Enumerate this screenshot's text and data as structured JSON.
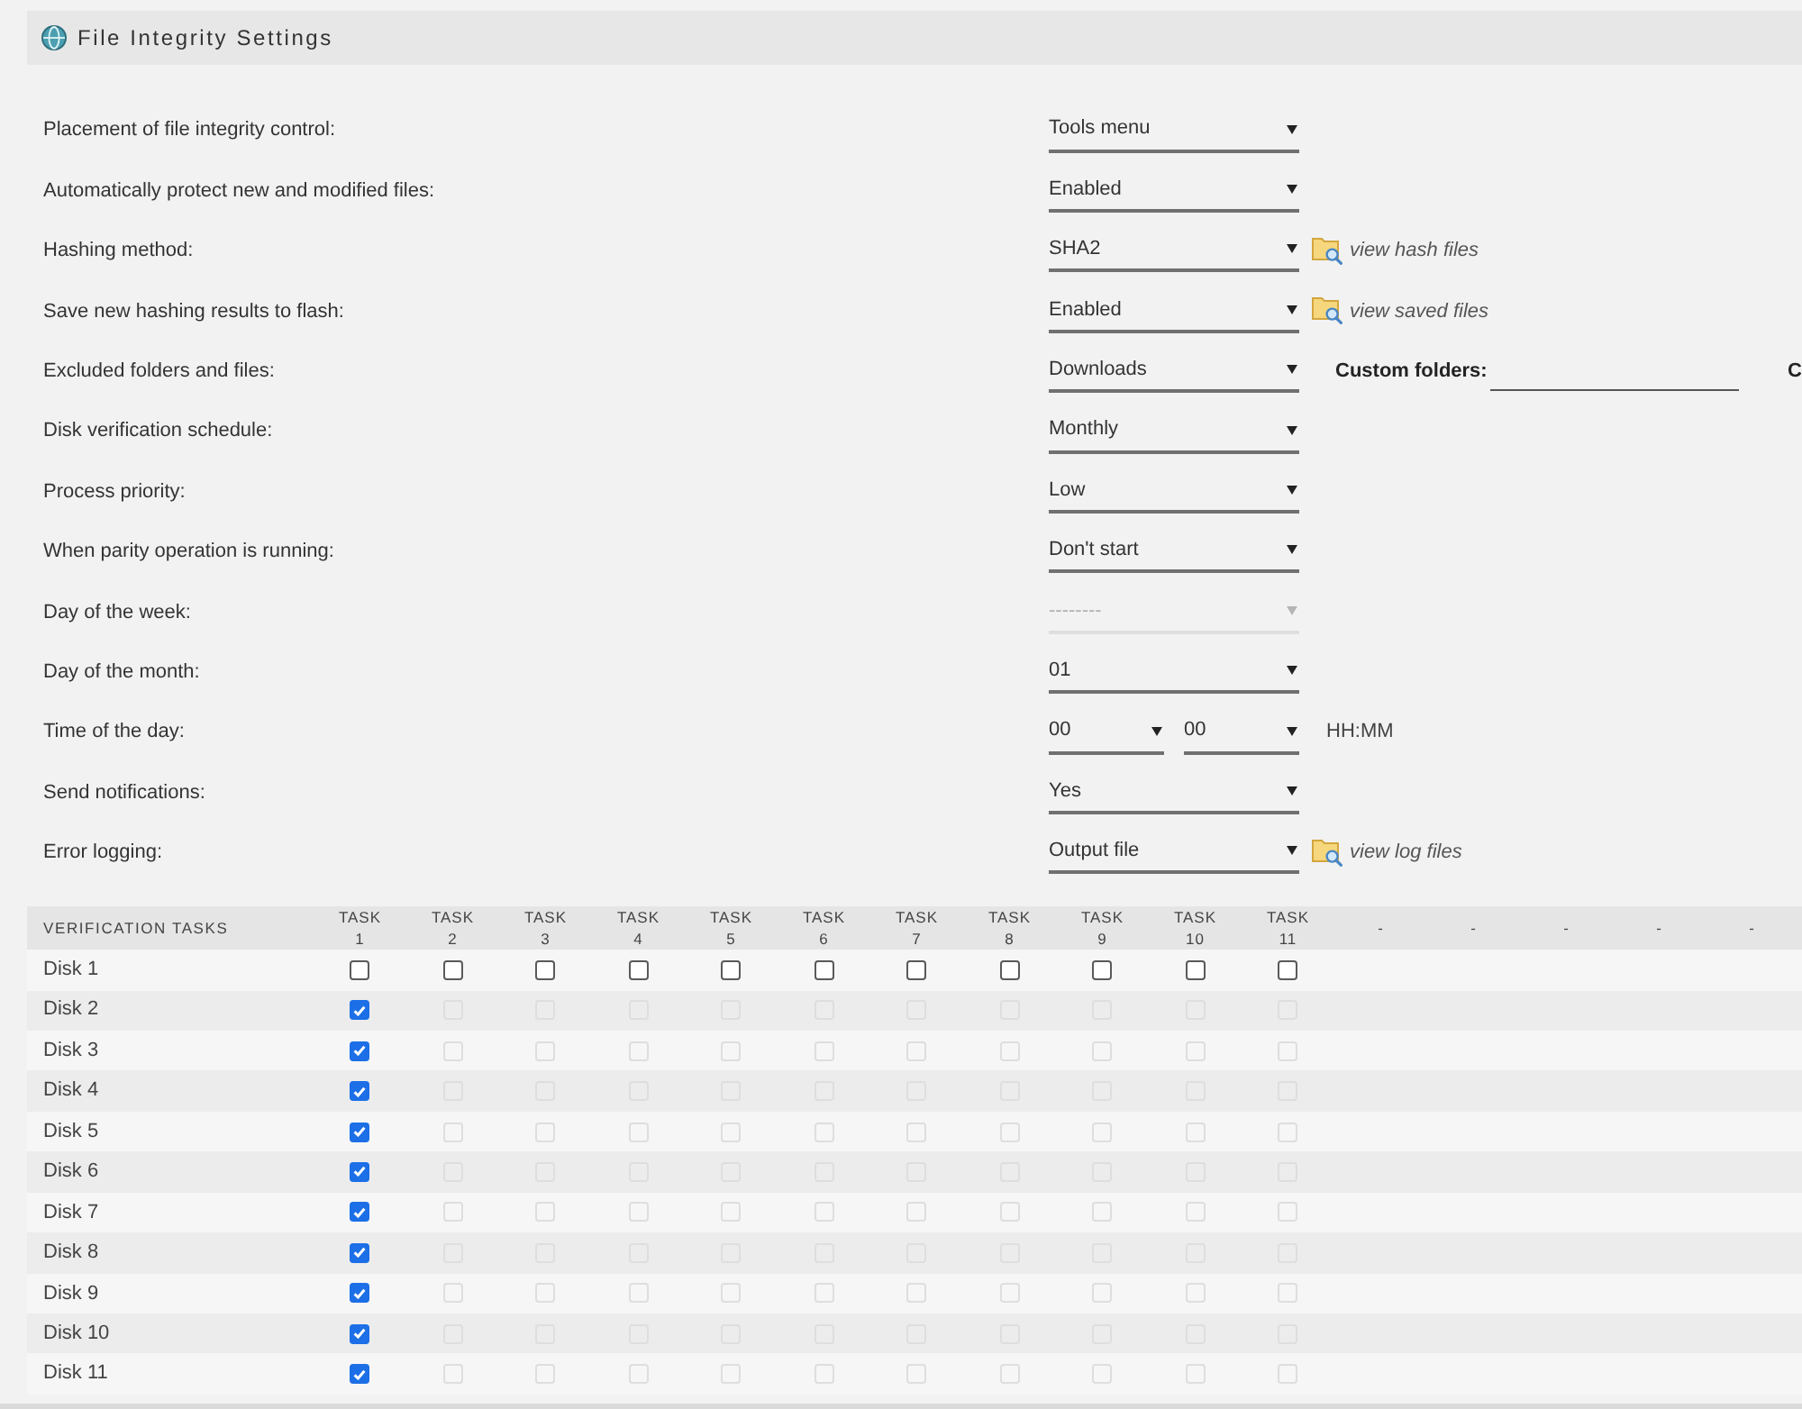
{
  "header": {
    "title": "File Integrity Settings"
  },
  "settings": [
    {
      "label": "Placement of file integrity control:",
      "selects": [
        {
          "value": "Tools menu",
          "disabled": false
        }
      ]
    },
    {
      "label": "Automatically protect new and modified files:",
      "selects": [
        {
          "value": "Enabled",
          "disabled": false
        }
      ]
    },
    {
      "label": "Hashing method:",
      "selects": [
        {
          "value": "SHA2",
          "disabled": false
        }
      ],
      "link": "view hash files"
    },
    {
      "label": "Save new hashing results to flash:",
      "selects": [
        {
          "value": "Enabled",
          "disabled": false
        }
      ],
      "link": "view saved files"
    },
    {
      "label": "Excluded folders and files:",
      "selects": [
        {
          "value": "Downloads",
          "disabled": false
        }
      ],
      "custom_field": {
        "label": "Custom folders:"
      },
      "cut_label": "C"
    },
    {
      "label": "Disk verification schedule:",
      "selects": [
        {
          "value": "Monthly",
          "disabled": false
        }
      ]
    },
    {
      "label": "Process priority:",
      "selects": [
        {
          "value": "Low",
          "disabled": false
        }
      ]
    },
    {
      "label": "When parity operation is running:",
      "selects": [
        {
          "value": "Don't start",
          "disabled": false
        }
      ]
    },
    {
      "label": "Day of the week:",
      "selects": [
        {
          "value": "--------",
          "disabled": true
        }
      ]
    },
    {
      "label": "Day of the month:",
      "selects": [
        {
          "value": "01",
          "disabled": false
        }
      ]
    },
    {
      "label": "Time of the day:",
      "selects": [
        {
          "value": "00",
          "disabled": false
        },
        {
          "value": "00",
          "disabled": false
        }
      ],
      "hint": "HH:MM"
    },
    {
      "label": "Send notifications:",
      "selects": [
        {
          "value": "Yes",
          "disabled": false
        }
      ]
    },
    {
      "label": "Error logging:",
      "selects": [
        {
          "value": "Output file",
          "disabled": false
        }
      ],
      "link": "view log files"
    }
  ],
  "table": {
    "columns": [
      "VERIFICATION TASKS",
      "TASK 1",
      "TASK 2",
      "TASK 3",
      "TASK 4",
      "TASK 5",
      "TASK 6",
      "TASK 7",
      "TASK 8",
      "TASK 9",
      "TASK 10",
      "TASK 11",
      "-",
      "-",
      "-",
      "-",
      "-"
    ],
    "rows": [
      {
        "label": "Disk 1",
        "cells": [
          {
            "checked": false,
            "disabled": false
          },
          {
            "checked": false,
            "disabled": false
          },
          {
            "checked": false,
            "disabled": false
          },
          {
            "checked": false,
            "disabled": false
          },
          {
            "checked": false,
            "disabled": false
          },
          {
            "checked": false,
            "disabled": false
          },
          {
            "checked": false,
            "disabled": false
          },
          {
            "checked": false,
            "disabled": false
          },
          {
            "checked": false,
            "disabled": false
          },
          {
            "checked": false,
            "disabled": false
          },
          {
            "checked": false,
            "disabled": false
          }
        ]
      },
      {
        "label": "Disk 2",
        "cells": [
          {
            "checked": true,
            "disabled": false
          },
          {
            "checked": false,
            "disabled": true
          },
          {
            "checked": false,
            "disabled": true
          },
          {
            "checked": false,
            "disabled": true
          },
          {
            "checked": false,
            "disabled": true
          },
          {
            "checked": false,
            "disabled": true
          },
          {
            "checked": false,
            "disabled": true
          },
          {
            "checked": false,
            "disabled": true
          },
          {
            "checked": false,
            "disabled": true
          },
          {
            "checked": false,
            "disabled": true
          },
          {
            "checked": false,
            "disabled": true
          }
        ]
      },
      {
        "label": "Disk 3",
        "cells": [
          {
            "checked": true,
            "disabled": false
          },
          {
            "checked": false,
            "disabled": true
          },
          {
            "checked": false,
            "disabled": true
          },
          {
            "checked": false,
            "disabled": true
          },
          {
            "checked": false,
            "disabled": true
          },
          {
            "checked": false,
            "disabled": true
          },
          {
            "checked": false,
            "disabled": true
          },
          {
            "checked": false,
            "disabled": true
          },
          {
            "checked": false,
            "disabled": true
          },
          {
            "checked": false,
            "disabled": true
          },
          {
            "checked": false,
            "disabled": true
          }
        ]
      },
      {
        "label": "Disk 4",
        "cells": [
          {
            "checked": true,
            "disabled": false
          },
          {
            "checked": false,
            "disabled": true
          },
          {
            "checked": false,
            "disabled": true
          },
          {
            "checked": false,
            "disabled": true
          },
          {
            "checked": false,
            "disabled": true
          },
          {
            "checked": false,
            "disabled": true
          },
          {
            "checked": false,
            "disabled": true
          },
          {
            "checked": false,
            "disabled": true
          },
          {
            "checked": false,
            "disabled": true
          },
          {
            "checked": false,
            "disabled": true
          },
          {
            "checked": false,
            "disabled": true
          }
        ]
      },
      {
        "label": "Disk 5",
        "cells": [
          {
            "checked": true,
            "disabled": false
          },
          {
            "checked": false,
            "disabled": true
          },
          {
            "checked": false,
            "disabled": true
          },
          {
            "checked": false,
            "disabled": true
          },
          {
            "checked": false,
            "disabled": true
          },
          {
            "checked": false,
            "disabled": true
          },
          {
            "checked": false,
            "disabled": true
          },
          {
            "checked": false,
            "disabled": true
          },
          {
            "checked": false,
            "disabled": true
          },
          {
            "checked": false,
            "disabled": true
          },
          {
            "checked": false,
            "disabled": true
          }
        ]
      },
      {
        "label": "Disk 6",
        "cells": [
          {
            "checked": true,
            "disabled": false
          },
          {
            "checked": false,
            "disabled": true
          },
          {
            "checked": false,
            "disabled": true
          },
          {
            "checked": false,
            "disabled": true
          },
          {
            "checked": false,
            "disabled": true
          },
          {
            "checked": false,
            "disabled": true
          },
          {
            "checked": false,
            "disabled": true
          },
          {
            "checked": false,
            "disabled": true
          },
          {
            "checked": false,
            "disabled": true
          },
          {
            "checked": false,
            "disabled": true
          },
          {
            "checked": false,
            "disabled": true
          }
        ]
      },
      {
        "label": "Disk 7",
        "cells": [
          {
            "checked": true,
            "disabled": false
          },
          {
            "checked": false,
            "disabled": true
          },
          {
            "checked": false,
            "disabled": true
          },
          {
            "checked": false,
            "disabled": true
          },
          {
            "checked": false,
            "disabled": true
          },
          {
            "checked": false,
            "disabled": true
          },
          {
            "checked": false,
            "disabled": true
          },
          {
            "checked": false,
            "disabled": true
          },
          {
            "checked": false,
            "disabled": true
          },
          {
            "checked": false,
            "disabled": true
          },
          {
            "checked": false,
            "disabled": true
          }
        ]
      },
      {
        "label": "Disk 8",
        "cells": [
          {
            "checked": true,
            "disabled": false
          },
          {
            "checked": false,
            "disabled": true
          },
          {
            "checked": false,
            "disabled": true
          },
          {
            "checked": false,
            "disabled": true
          },
          {
            "checked": false,
            "disabled": true
          },
          {
            "checked": false,
            "disabled": true
          },
          {
            "checked": false,
            "disabled": true
          },
          {
            "checked": false,
            "disabled": true
          },
          {
            "checked": false,
            "disabled": true
          },
          {
            "checked": false,
            "disabled": true
          },
          {
            "checked": false,
            "disabled": true
          }
        ]
      },
      {
        "label": "Disk 9",
        "cells": [
          {
            "checked": true,
            "disabled": false
          },
          {
            "checked": false,
            "disabled": true
          },
          {
            "checked": false,
            "disabled": true
          },
          {
            "checked": false,
            "disabled": true
          },
          {
            "checked": false,
            "disabled": true
          },
          {
            "checked": false,
            "disabled": true
          },
          {
            "checked": false,
            "disabled": true
          },
          {
            "checked": false,
            "disabled": true
          },
          {
            "checked": false,
            "disabled": true
          },
          {
            "checked": false,
            "disabled": true
          },
          {
            "checked": false,
            "disabled": true
          }
        ]
      },
      {
        "label": "Disk 10",
        "cells": [
          {
            "checked": true,
            "disabled": false
          },
          {
            "checked": false,
            "disabled": true
          },
          {
            "checked": false,
            "disabled": true
          },
          {
            "checked": false,
            "disabled": true
          },
          {
            "checked": false,
            "disabled": true
          },
          {
            "checked": false,
            "disabled": true
          },
          {
            "checked": false,
            "disabled": true
          },
          {
            "checked": false,
            "disabled": true
          },
          {
            "checked": false,
            "disabled": true
          },
          {
            "checked": false,
            "disabled": true
          },
          {
            "checked": false,
            "disabled": true
          }
        ]
      },
      {
        "label": "Disk 11",
        "cells": [
          {
            "checked": true,
            "disabled": false
          },
          {
            "checked": false,
            "disabled": true
          },
          {
            "checked": false,
            "disabled": true
          },
          {
            "checked": false,
            "disabled": true
          },
          {
            "checked": false,
            "disabled": true
          },
          {
            "checked": false,
            "disabled": true
          },
          {
            "checked": false,
            "disabled": true
          },
          {
            "checked": false,
            "disabled": true
          },
          {
            "checked": false,
            "disabled": true
          },
          {
            "checked": false,
            "disabled": true
          },
          {
            "checked": false,
            "disabled": true
          }
        ]
      }
    ]
  }
}
